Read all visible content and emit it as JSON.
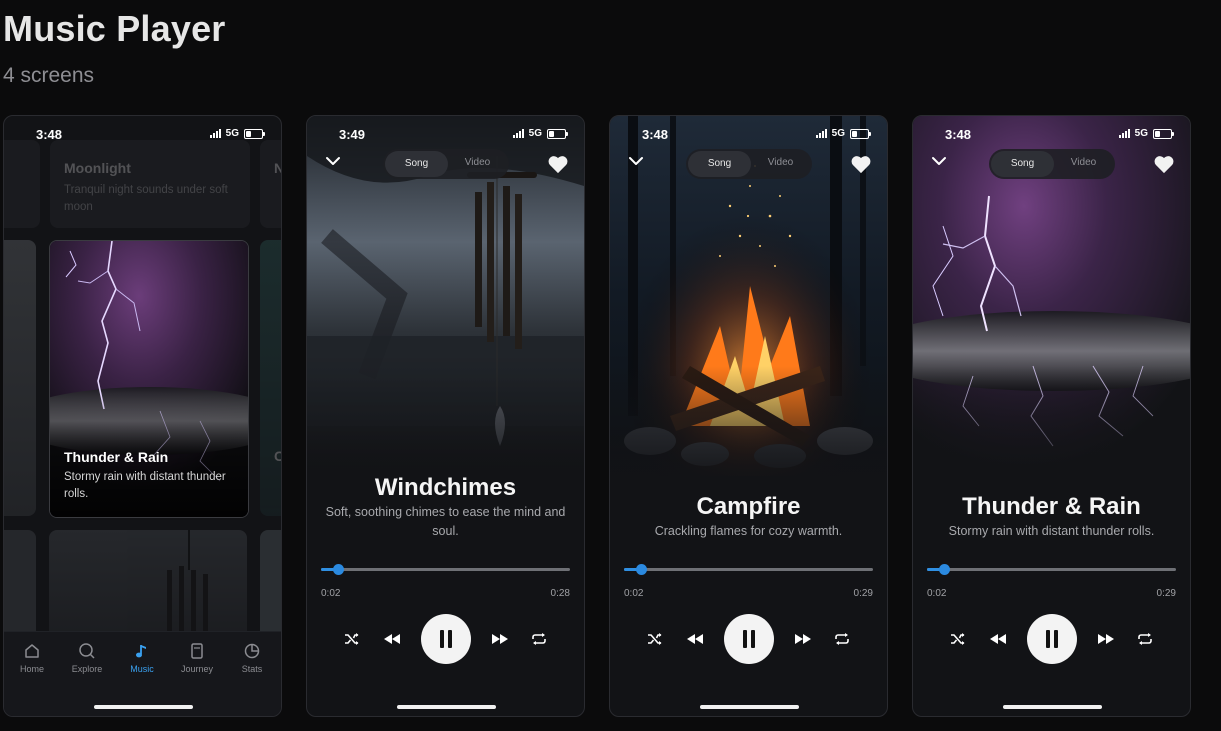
{
  "page": {
    "title": "Music Player",
    "subtitle": "4 screens"
  },
  "status": {
    "time_1": "3:48",
    "time_2": "3:49",
    "time_3": "3:48",
    "time_4": "3:48",
    "network": "5G"
  },
  "library": {
    "cards": [
      {
        "title": "Moonlight",
        "desc": "Tranquil night sounds under soft moon"
      },
      {
        "title": "Thunder & Rain",
        "desc": "Stormy rain with distant thunder rolls."
      }
    ],
    "peek_right_top": "N",
    "peek_right_mid": "C"
  },
  "nav": {
    "items": [
      {
        "label": "Home",
        "icon": "home-icon"
      },
      {
        "label": "Explore",
        "icon": "search-icon"
      },
      {
        "label": "Music",
        "icon": "music-note-icon"
      },
      {
        "label": "Journey",
        "icon": "book-icon"
      },
      {
        "label": "Stats",
        "icon": "pie-chart-icon"
      }
    ],
    "active": "Music",
    "active_color": "#3aa1f0"
  },
  "player_toggle": {
    "song": "Song",
    "video": "Video"
  },
  "players": [
    {
      "title": "Windchimes",
      "desc": "Soft, soothing chimes to ease the mind and soul.",
      "elapsed": "0:02",
      "duration": "0:28",
      "progress": 0.07
    },
    {
      "title": "Campfire",
      "desc": "Crackling flames for cozy warmth.",
      "elapsed": "0:02",
      "duration": "0:29",
      "progress": 0.07
    },
    {
      "title": "Thunder & Rain",
      "desc": "Stormy rain with distant thunder rolls.",
      "elapsed": "0:02",
      "duration": "0:29",
      "progress": 0.07
    }
  ],
  "colors": {
    "accent": "#2f8fe2",
    "background": "#0b0b0c",
    "screen": "#121316"
  }
}
